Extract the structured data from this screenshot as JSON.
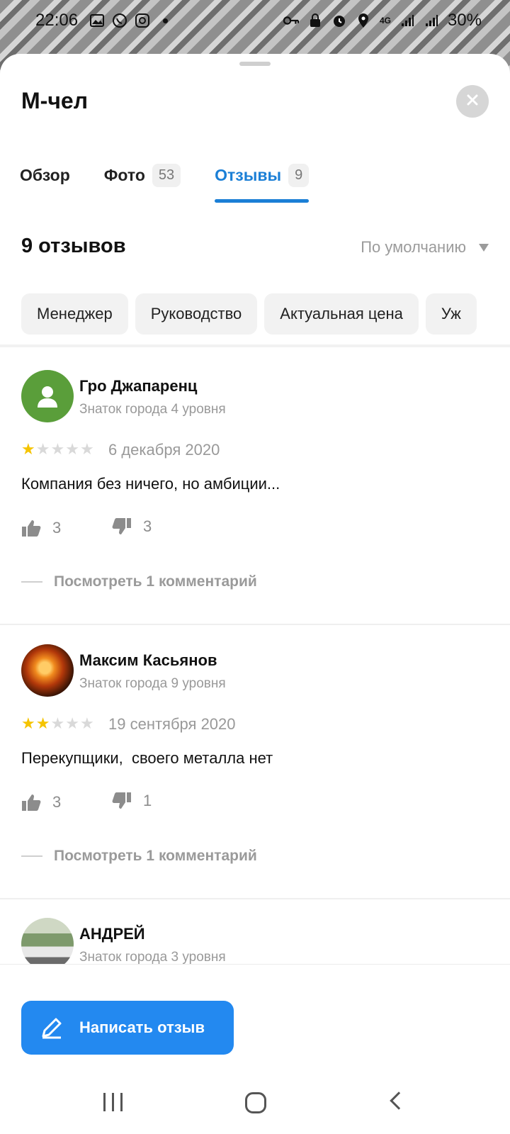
{
  "status_bar": {
    "time": "22:06",
    "network": "4G",
    "battery": "30%"
  },
  "place": {
    "title": "М-чел"
  },
  "tabs": [
    {
      "label": "Обзор",
      "count": "",
      "active": false
    },
    {
      "label": "Фото",
      "count": "53",
      "active": false
    },
    {
      "label": "Отзывы",
      "count": "9",
      "active": true
    }
  ],
  "reviews_header": {
    "count_label": "9 отзывов",
    "sort_label": "По умолчанию"
  },
  "chips": [
    "Менеджер",
    "Руководство",
    "Актуальная цена",
    "Уж"
  ],
  "reviews": [
    {
      "author": "Гро Джапаренц",
      "level": "Знаток города 4 уровня",
      "rating": 1,
      "date": "6 декабря 2020",
      "text": "Компания без ничего, но амбиции...",
      "likes": "3",
      "dislikes": "3",
      "comments_link": "Посмотреть 1 комментарий"
    },
    {
      "author": "Максим Касьянов",
      "level": "Знаток города 9 уровня",
      "rating": 2,
      "date": "19 сентября 2020",
      "text": "Перекупщики,  своего металла нет",
      "likes": "3",
      "dislikes": "1",
      "comments_link": "Посмотреть 1 комментарий"
    },
    {
      "author": "АНДРЕЙ",
      "level": "Знаток города 3 уровня"
    }
  ],
  "actions": {
    "write_review": "Написать отзыв"
  },
  "colors": {
    "accent": "#2389f0",
    "tab_active": "#1b7fd6",
    "star_on": "#f5c400",
    "star_off": "#d9d9d9"
  }
}
